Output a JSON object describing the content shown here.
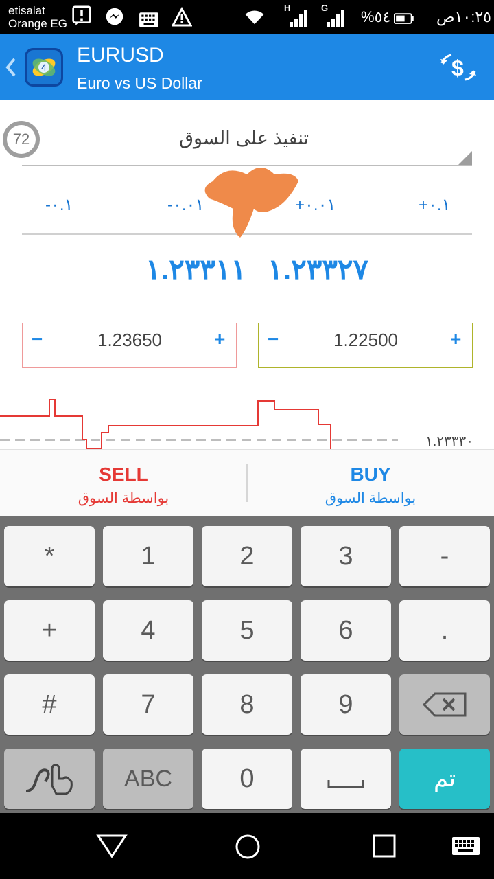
{
  "status_bar": {
    "carrier_line1": "etisalat",
    "carrier_line2": "Orange EG",
    "battery_percent": "%٥٤",
    "time": "١٠:٢٥ص",
    "network_h": "H",
    "network_g": "G"
  },
  "app_bar": {
    "back_icon": "chevron-left-icon",
    "logo_icon": "metatrader-logo-icon",
    "title": "EURUSD",
    "subtitle": "Euro vs US Dollar",
    "action_icon": "dollar-exchange-icon"
  },
  "order": {
    "gauge_value": "72",
    "order_type": "تنفيذ على السوق",
    "volume": {
      "minus_big": "-٠.١",
      "minus_small": "-٠.٠١",
      "plus_small": "+٠.٠١",
      "plus_big": "+٠.١"
    },
    "sell_price": "١.٢٣٣١١",
    "buy_price": "١.٢٣٣٢٧",
    "stop_loss": {
      "value": "1.23650",
      "minus": "−",
      "plus": "+"
    },
    "take_profit": {
      "value": "1.22500",
      "minus": "−",
      "plus": "+"
    }
  },
  "chart": {
    "price_label": "١.٢٣٣٣٠",
    "colors": {
      "line": "#e53935",
      "dashed": "#bdbdbd"
    }
  },
  "trade": {
    "sell_label": "SELL",
    "sell_sub": "بواسطة السوق",
    "buy_label": "BUY",
    "buy_sub": "بواسطة السوق",
    "colors": {
      "sell": "#e53935",
      "buy": "#1e88e5"
    }
  },
  "keyboard": {
    "row1": [
      "*",
      "1",
      "2",
      "3",
      "-"
    ],
    "row2": [
      "+",
      "4",
      "5",
      "6",
      "."
    ],
    "row3": [
      "#",
      "7",
      "8",
      "9"
    ],
    "backspace_icon": "backspace-icon",
    "handwriting_icon": "handwriting-icon",
    "abc": "ABC",
    "zero": "0",
    "space_icon": "space-bar-icon",
    "done": "تم"
  },
  "nav_bar": {
    "back_icon": "triangle-back-icon",
    "home_icon": "circle-home-icon",
    "recents_icon": "square-recents-icon",
    "keyboard_icon": "keyboard-icon"
  }
}
